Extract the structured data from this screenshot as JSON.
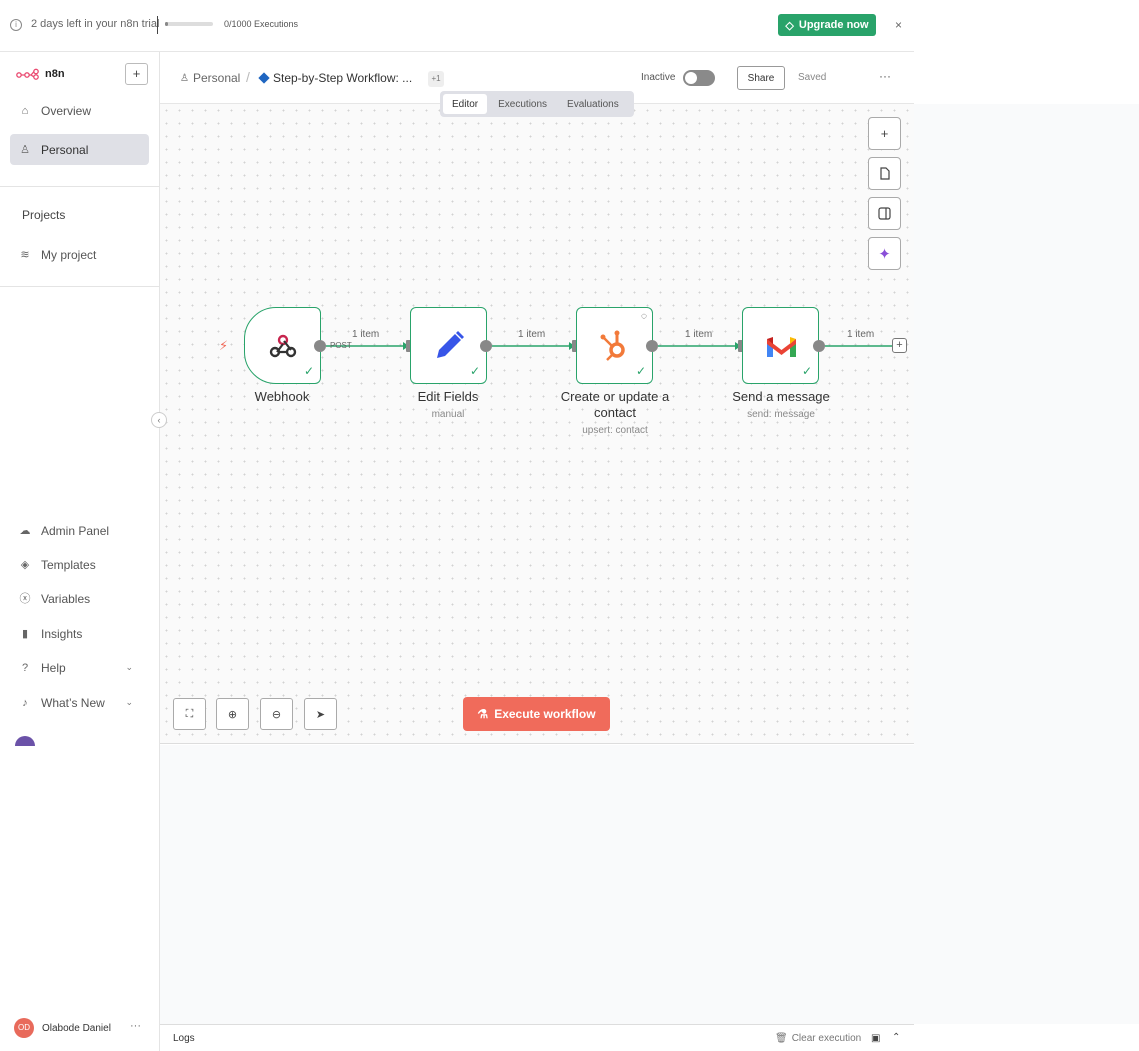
{
  "banner": {
    "trial_text": "2 days left in your n8n trial",
    "executions_text": "0/1000 Executions",
    "executions_progress": 0.0,
    "upgrade_label": "Upgrade now",
    "close_glyph": "×"
  },
  "sidebar": {
    "logo_text": "n8n",
    "add_glyph": "+",
    "items": [
      {
        "label": "Overview",
        "icon": "home-icon"
      },
      {
        "label": "Personal",
        "icon": "user-icon",
        "active": true
      }
    ],
    "projects_title": "Projects",
    "projects": [
      {
        "label": "My project",
        "icon": "layers-icon"
      }
    ],
    "bottom_items": [
      {
        "label": "Admin Panel",
        "icon": "cloud-icon"
      },
      {
        "label": "Templates",
        "icon": "box-icon"
      },
      {
        "label": "Variables",
        "icon": "variable-icon"
      },
      {
        "label": "Insights",
        "icon": "chart-icon"
      },
      {
        "label": "Help",
        "icon": "help-icon"
      },
      {
        "label": "What’s New",
        "icon": "bell-icon"
      }
    ],
    "user": {
      "initials": "OD",
      "name": "Olabode Daniel"
    }
  },
  "header": {
    "crumb_personal": "Personal",
    "crumb_separator": "/",
    "workflow_name": "Step-by-Step Workflow: ...",
    "tag_count": "+1",
    "status_label": "Inactive",
    "share_label": "Share",
    "saved_label": "Saved",
    "more_glyph": "···"
  },
  "tabs": [
    {
      "label": "Editor",
      "active": true
    },
    {
      "label": "Executions"
    },
    {
      "label": "Evaluations"
    }
  ],
  "workflow": {
    "trigger_method": "POST",
    "nodes": [
      {
        "title": "Webhook",
        "subtitle": "",
        "icon": "webhook-icon"
      },
      {
        "title": "Edit Fields",
        "subtitle": "manual",
        "icon": "pencil-icon"
      },
      {
        "title": "Create or update a contact",
        "subtitle": "upsert: contact",
        "icon": "hubspot-icon"
      },
      {
        "title": "Send a message",
        "subtitle": "send: message",
        "icon": "gmail-icon"
      }
    ],
    "edges": [
      "1 item",
      "1 item",
      "1 item",
      "1 item"
    ]
  },
  "execute_label": "Execute workflow",
  "logs": {
    "label": "Logs",
    "clear_label": "Clear execution"
  },
  "colors": {
    "success": "#29a36a",
    "accent": "#f06b5b",
    "upgrade": "#29a36a"
  }
}
